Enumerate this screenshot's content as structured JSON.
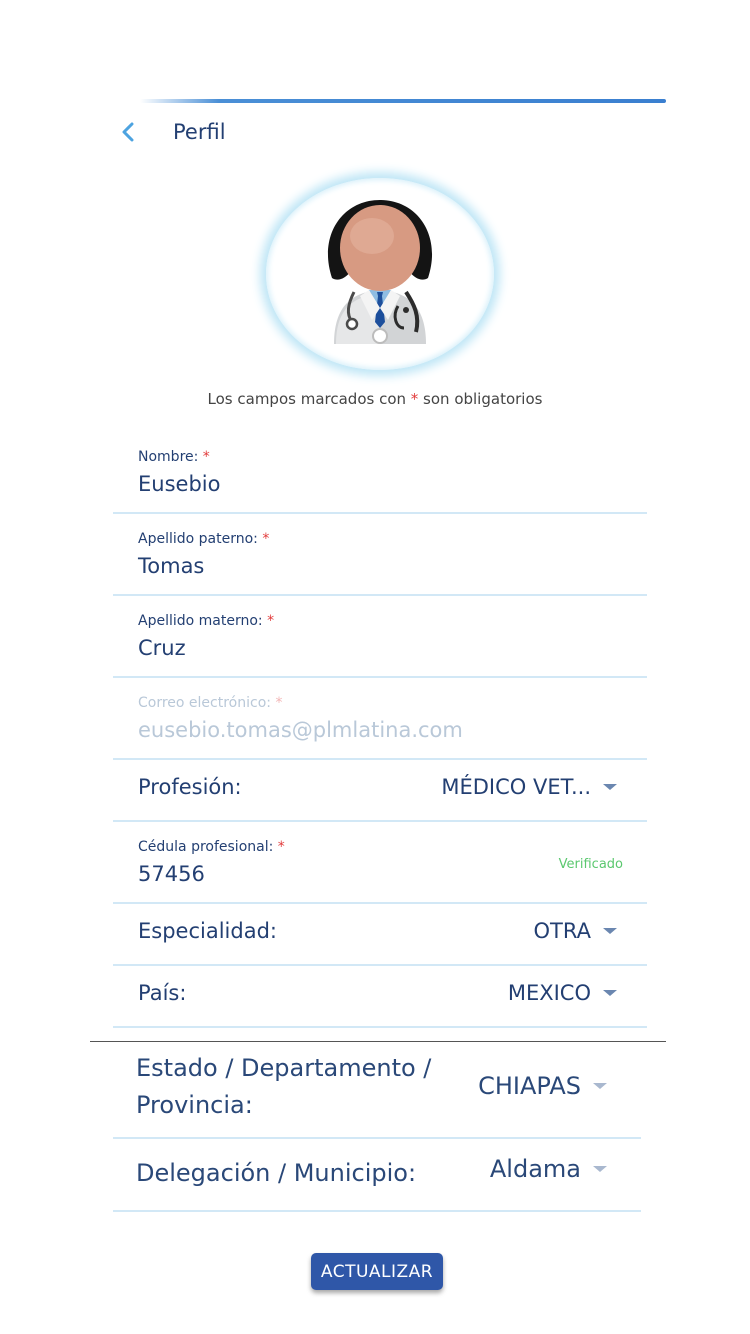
{
  "header": {
    "title": "Perfil"
  },
  "notice": {
    "before": "Los campos marcados con ",
    "star": "*",
    "after": " son obligatorios"
  },
  "fields": {
    "nombre": {
      "label": "Nombre: ",
      "star": "*",
      "value": "Eusebio"
    },
    "apellido_paterno": {
      "label": "Apellido paterno: ",
      "star": "*",
      "value": "Tomas"
    },
    "apellido_materno": {
      "label": "Apellido materno: ",
      "star": "*",
      "value": "Cruz"
    },
    "correo": {
      "label": "Correo electrónico: ",
      "star": "*",
      "value": "eusebio.tomas@plmlatina.com",
      "disabled": true
    },
    "profesion": {
      "label": "Profesión:",
      "value": "MÉDICO VET..."
    },
    "cedula": {
      "label": "Cédula profesional: ",
      "star": "*",
      "value": "57456",
      "status": "Verificado"
    },
    "especialidad": {
      "label": "Especialidad:",
      "value": "OTRA"
    },
    "pais": {
      "label": "País:",
      "value": "MEXICO"
    },
    "estado": {
      "label_line1": "Estado / Departamento /",
      "label_line2": "Provincia:",
      "value": "CHIAPAS"
    },
    "municipio": {
      "label": "Delegación / Municipio:",
      "value": "Aldama"
    }
  },
  "button": {
    "label": "ACTUALIZAR"
  },
  "colors": {
    "accent": "#2f57a8",
    "text": "#233f72",
    "required": "#e23b3b",
    "verified": "#5bc86f",
    "divider": "#d2e8f6"
  },
  "icons": {
    "back": "chevron-left-icon",
    "avatar": "doctor-avatar-icon",
    "dropdown": "caret-down-icon"
  }
}
